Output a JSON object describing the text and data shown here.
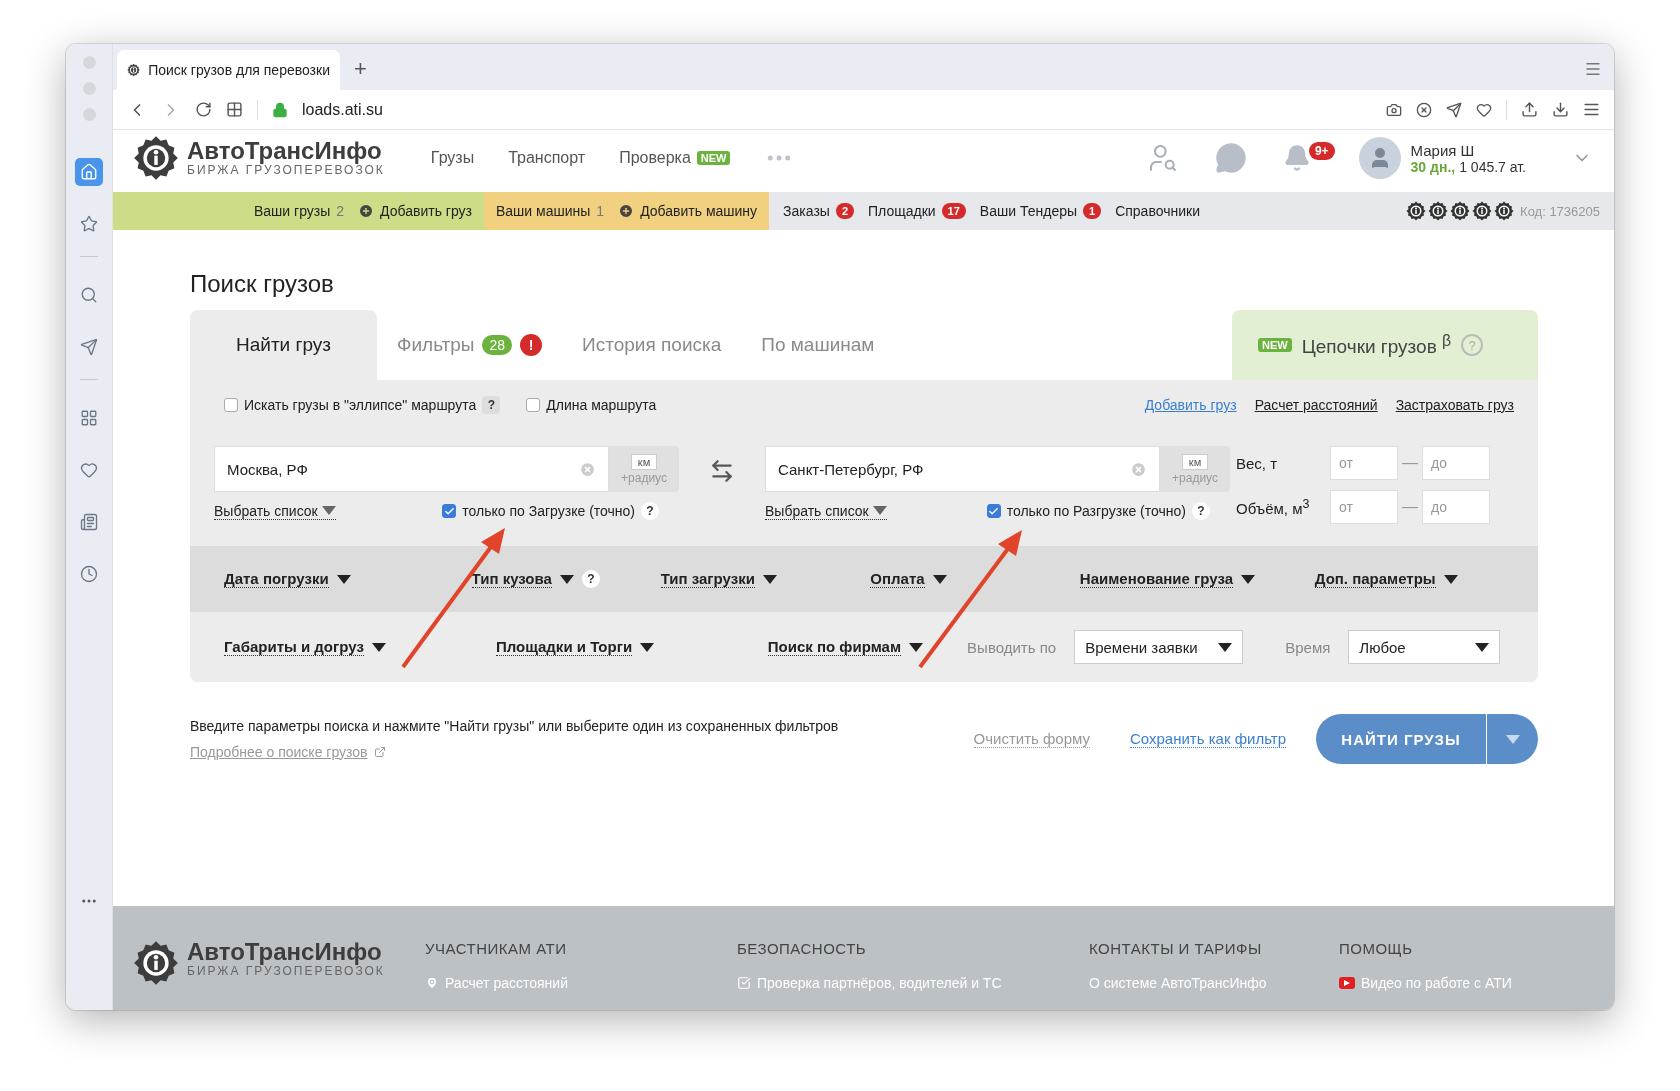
{
  "browser": {
    "tab_title": "Поиск грузов для перевозки",
    "new_tab": "+",
    "url": "loads.ati.su"
  },
  "sidebar": {
    "items": [
      {
        "kind": "home",
        "selected": true
      },
      {
        "kind": "star",
        "selected": false
      },
      {
        "kind": "search",
        "selected": false
      },
      {
        "kind": "send",
        "selected": false
      },
      {
        "kind": "grid",
        "selected": false
      },
      {
        "kind": "heart",
        "selected": false
      },
      {
        "kind": "news",
        "selected": false
      },
      {
        "kind": "clock",
        "selected": false
      }
    ]
  },
  "header": {
    "logo": {
      "name": "АвтоТрансИнфо",
      "tagline": "БИРЖА ГРУЗОПЕРЕВОЗОК"
    },
    "nav": [
      {
        "label": "Грузы"
      },
      {
        "label": "Транспорт"
      },
      {
        "label": "Проверка",
        "badge": "NEW"
      }
    ],
    "notifications": "9+",
    "user": {
      "name": "Мария Ш",
      "days": "30 дн.,",
      "balance": "1 045.7 ат."
    }
  },
  "strip": {
    "groups": [
      {
        "color": "#cddc86",
        "label": "Ваши грузы",
        "count": "2",
        "action": "Добавить груз"
      },
      {
        "color": "#f1d17f",
        "label": "Ваши машины",
        "count": "1",
        "action": "Добавить машину"
      }
    ],
    "links": [
      {
        "label": "Заказы",
        "badge": "2"
      },
      {
        "label": "Площадки",
        "badge": "17"
      },
      {
        "label": "Ваши Тендеры",
        "badge": "1"
      },
      {
        "label": "Справочники"
      }
    ],
    "code": "Код: 1736205"
  },
  "page_title": "Поиск грузов",
  "tabs": [
    {
      "label": "Найти груз",
      "selected": true
    },
    {
      "label": "Фильтры",
      "count": "28",
      "alert": "!",
      "selected": false
    },
    {
      "label": "История поиска",
      "selected": false
    },
    {
      "label": "По машинам",
      "selected": false
    }
  ],
  "chain_tab": {
    "badge": "NEW",
    "label": "Цепочки грузов $^{β}$",
    "help": "?"
  },
  "options": [
    {
      "label": "Искать грузы в \"эллипсе\" маршрута",
      "checked": false,
      "help": "?"
    },
    {
      "label": "Длина маршрута",
      "checked": false
    }
  ],
  "links": [
    {
      "label": "Добавить груз",
      "kind": "accent"
    },
    {
      "label": "Расчет расстояний",
      "kind": "plain"
    },
    {
      "label": "Застраховать груз",
      "kind": "plain"
    }
  ],
  "route": [
    {
      "value": "Москва, РФ",
      "unit": "км",
      "radius": "+радиус",
      "list": "Выбрать список",
      "exact": {
        "label": "только по Загрузке (точно)",
        "checked": true,
        "help": "?"
      }
    },
    {
      "value": "Санкт-Петербург, РФ",
      "unit": "км",
      "radius": "+радиус",
      "list": "Выбрать список",
      "exact": {
        "label": "только по Разгрузке (точно)",
        "checked": true,
        "help": "?"
      }
    }
  ],
  "ranges": [
    {
      "label": "Вес, т",
      "from": "от",
      "dash": "—",
      "to": "до"
    },
    {
      "label": "Объём, м$^{3}$",
      "from": "от",
      "dash": "—",
      "to": "до"
    }
  ],
  "filters_row1": [
    {
      "label": "Дата погрузки"
    },
    {
      "label": "Тип кузова",
      "help": "?"
    },
    {
      "label": "Тип загрузки"
    },
    {
      "label": "Оплата"
    },
    {
      "label": "Наименование груза"
    },
    {
      "label": "Доп. параметры"
    }
  ],
  "filters_row2": [
    {
      "label": "Габариты и догруз"
    },
    {
      "label": "Площадки и Торги"
    },
    {
      "label": "Поиск по фирмам"
    }
  ],
  "selects": [
    {
      "label": "Выводить по",
      "value": "Времени заявки"
    },
    {
      "label": "Время",
      "value": "Любое"
    }
  ],
  "hint": "Введите параметры поиска и нажмите \"Найти грузы\" или выберите один из сохраненных фильтров",
  "more_link": "Подробнее о поиске грузов",
  "clear": "Очистить форму",
  "save": "Сохранить как фильтр",
  "find": "НАЙТИ ГРУЗЫ",
  "footer": {
    "logo": {
      "name": "АвтоТрансИнфо",
      "tagline": "БИРЖА ГРУЗОПЕРЕВОЗОК"
    },
    "columns": [
      {
        "title": "УЧАСТНИКАМ АТИ",
        "item": "Расчет расстояний",
        "kind": "pin"
      },
      {
        "title": "БЕЗОПАСНОСТЬ",
        "item": "Проверка партнёров, водителей и ТС",
        "kind": "check"
      },
      {
        "title": "КОНТАКТЫ И ТАРИФЫ",
        "item": "О системе АвтоТрансИнфо",
        "kind": "none"
      },
      {
        "title": "ПОМОЩЬ",
        "item": "Видео по работе с АТИ",
        "kind": "video"
      }
    ]
  }
}
